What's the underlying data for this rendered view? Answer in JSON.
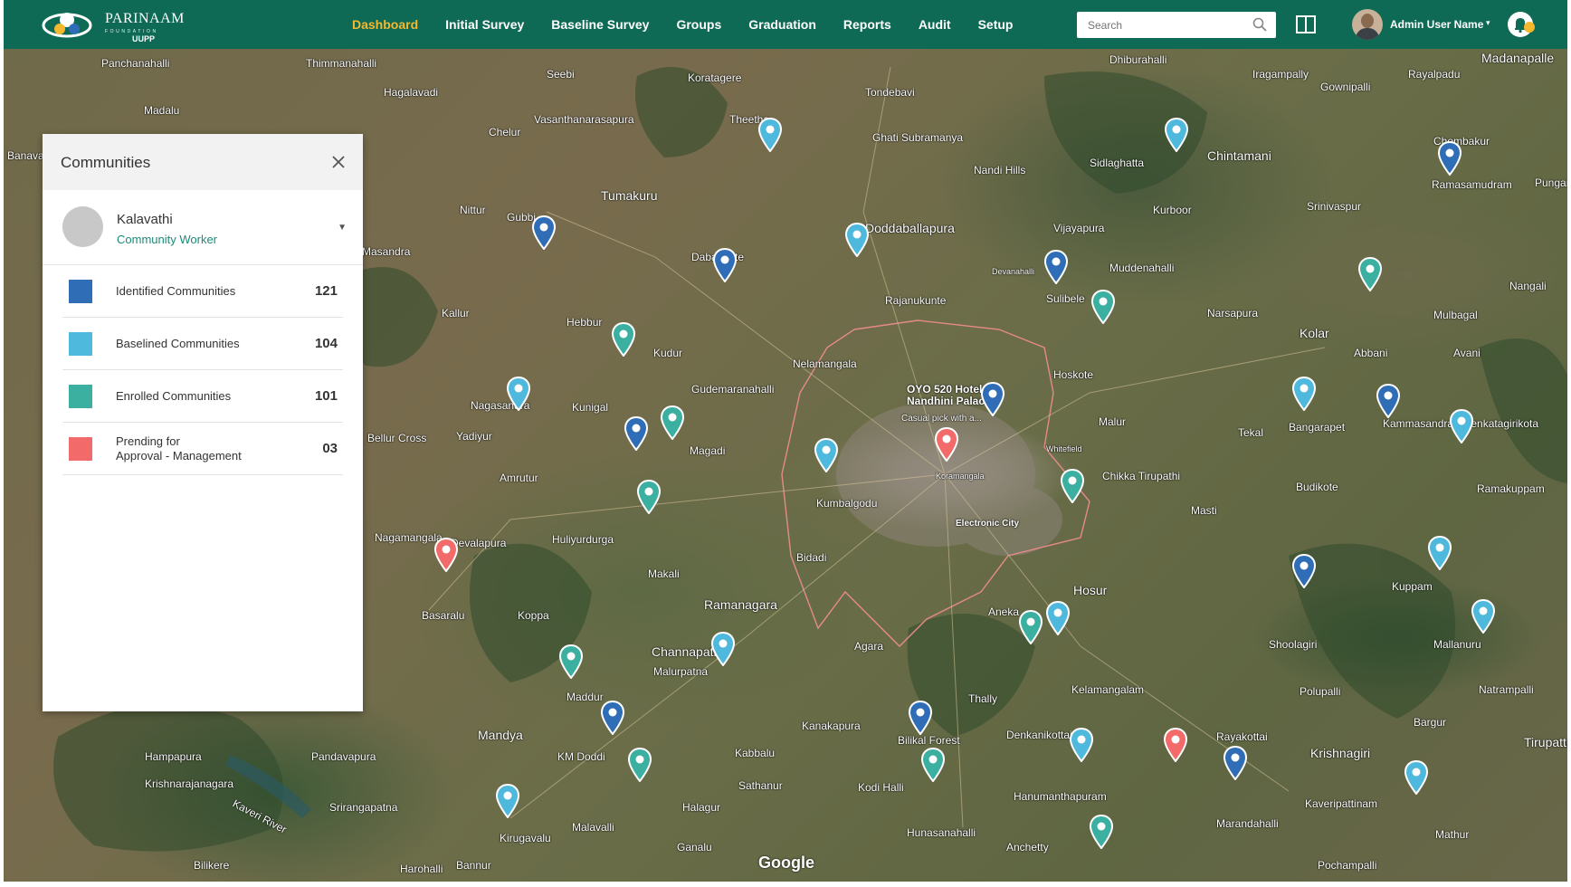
{
  "brand": {
    "name": "PARINAAM",
    "subtitle": "FOUNDATION",
    "tag": "UUPP"
  },
  "nav": {
    "items": [
      {
        "label": "Dashboard",
        "active": true
      },
      {
        "label": "Initial Survey",
        "active": false
      },
      {
        "label": "Baseline Survey",
        "active": false
      },
      {
        "label": "Groups",
        "active": false
      },
      {
        "label": "Graduation",
        "active": false
      },
      {
        "label": "Reports",
        "active": false
      },
      {
        "label": "Audit",
        "active": false
      },
      {
        "label": "Setup",
        "active": false
      }
    ]
  },
  "search": {
    "placeholder": "Search",
    "value": ""
  },
  "user": {
    "name": "Admin User Name"
  },
  "colors": {
    "header": "#0e6a55",
    "accent": "#f5b82e",
    "identified": "#2f6db7",
    "baselined": "#4fb8dd",
    "enrolled": "#3bafa0",
    "pending": "#f26a6a"
  },
  "communities_panel": {
    "title": "Communities",
    "worker": {
      "name": "Kalavathi",
      "role": "Community Worker"
    },
    "stats": [
      {
        "label": "Identified Communities",
        "count": "121",
        "color": "#2f6db7"
      },
      {
        "label": "Baselined Communities",
        "count": "104",
        "color": "#4fb8dd"
      },
      {
        "label": "Enrolled Communities",
        "count": "101",
        "color": "#3bafa0"
      },
      {
        "label_line1": "Prending for",
        "label_line2": "Approval - Management",
        "count": "03",
        "color": "#f26a6a"
      }
    ]
  },
  "map": {
    "attribution": "Google",
    "places": [
      "Panchanahalli",
      "Thimmanahalli",
      "Seebi",
      "Koratagere",
      "Tondebavi",
      "Dhiburahalli",
      "Iragampally",
      "Gownipalli",
      "Rayalpadu",
      "Madanapalle",
      "Madalu",
      "Hagalavadi",
      "Vasanthanarasapura",
      "Theetha",
      "Ghati Subramanya",
      "Nandi Hills",
      "Sidlaghatta",
      "Chintamani",
      "Chembakur",
      "Ramasamudram",
      "Banavara",
      "Chelur",
      "Tumakuru",
      "Doddaballapura",
      "Vijayapura",
      "Kurboor",
      "Srinivaspur",
      "Punganur",
      "Nittur",
      "Gubbi",
      "Dabaspete",
      "Devanahalli",
      "Muddenahalli",
      "Sulibele",
      "Nangali",
      "Masandra",
      "Kallur",
      "Hebbur",
      "Rajanukunte",
      "Narsapura",
      "Kolar",
      "Mulbagal",
      "Abbani",
      "Avani",
      "Kudur",
      "Nelamangala",
      "Gudemaranahalli",
      "Nagasandra",
      "Kunigal",
      "OYO 520 Hotel Nandhini Palace",
      "Casual pick with a...",
      "Hoskote",
      "Malur",
      "Tekal",
      "Bangarapet",
      "Kammasandra",
      "Venkatagirikota",
      "Bellur Cross",
      "Yadiyur",
      "Magadi",
      "Whitefield",
      "Koramangala",
      "Chikka Tirupathi",
      "Budikote",
      "Ramakuppam",
      "Amrutur",
      "Kumbalgodu",
      "Electronic City",
      "Masti",
      "Nagamangala",
      "Devalapura",
      "Huliyurdurga",
      "Bidadi",
      "Makali",
      "Hosur",
      "Kuppam",
      "Basaralu",
      "Koppa",
      "Ramanagara",
      "Aneka",
      "Shoolagiri",
      "Mallanuru",
      "Channapatna",
      "Malurpatna",
      "Agara",
      "Kelamangalam",
      "Polupalli",
      "Natrampalli",
      "Maddur",
      "Mandya",
      "Kanakapura",
      "Thally",
      "Bilikal Forest",
      "Denkanikottai",
      "Rayakottai",
      "Krishnagiri",
      "Bargur",
      "Tirupattur",
      "Hampapura",
      "Pandavapura",
      "KM Doddi",
      "Kabbalu",
      "Sathanur",
      "Kaveri River",
      "Krishnarajanagara",
      "Srirangapatna",
      "Kodi Halli",
      "Hanumanthapuram",
      "Kaveripattinam",
      "Marandahalli",
      "Halagur",
      "Kirugavalu",
      "Malavalli",
      "Hunasanahalli",
      "Anchetty",
      "Mathur",
      "Ganalu",
      "Bilikere",
      "Harohalli",
      "Bannur",
      "Pochampalli"
    ]
  }
}
